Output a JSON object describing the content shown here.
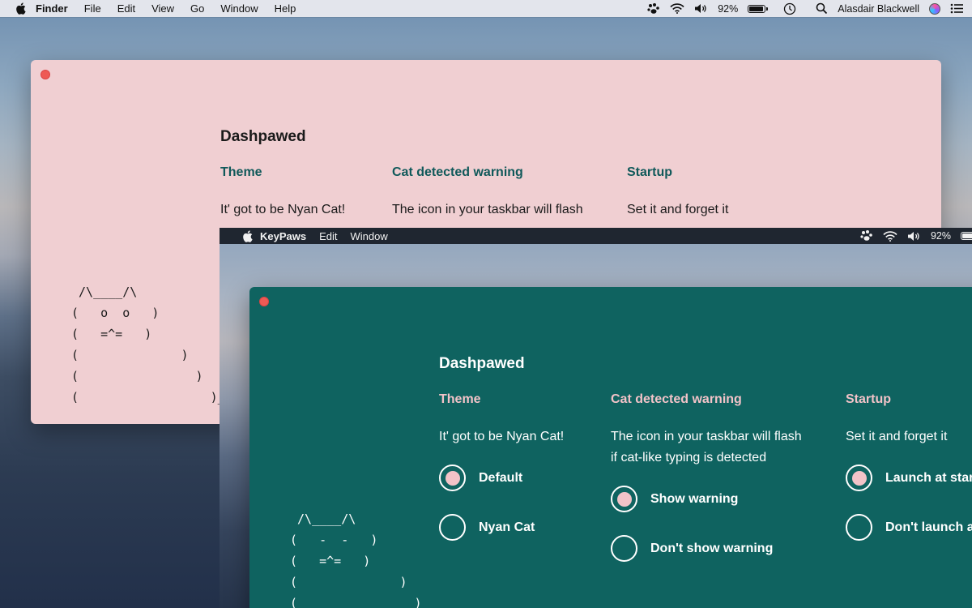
{
  "menubar": {
    "apple_icon": "apple-logo-icon",
    "app_name": "Finder",
    "items": [
      "File",
      "Edit",
      "View",
      "Go",
      "Window",
      "Help"
    ],
    "status": {
      "paw_icon": "paw-icon",
      "wifi_icon": "wifi-icon",
      "volume_icon": "volume-icon",
      "battery_percent": "92%",
      "battery_level": 0.92,
      "clock_icon": "clock-icon",
      "search_icon": "spotlight-search-icon",
      "user_name": "Alasdair Blackwell",
      "siri_icon": "siri-icon",
      "list_icon": "notification-center-icon"
    }
  },
  "pink_window": {
    "title": "Dashpawed",
    "ascii_cat": " /\\____/\\\n(   o  o   )\n(   =^=   )\n(              )\n(                )\n(                  )_____£",
    "columns": [
      {
        "heading": "Theme",
        "description": "It' got to be Nyan Cat!"
      },
      {
        "heading": "Cat detected warning",
        "description": "The icon in your taskbar will flash"
      },
      {
        "heading": "Startup",
        "description": "Set it and forget it"
      }
    ]
  },
  "screen2": {
    "menubar": {
      "app_name": "KeyPaws",
      "items": [
        "Edit",
        "Window"
      ],
      "battery_percent": "92%"
    },
    "window": {
      "title": "Dashpawed",
      "ascii_cat": " /\\____/\\\n(   -  -   )\n(   =^=   )\n(              )\n(                )",
      "columns": [
        {
          "heading": "Theme",
          "description": "It' got to be Nyan Cat!",
          "options": [
            {
              "label": "Default",
              "selected": true
            },
            {
              "label": "Nyan Cat",
              "selected": false
            }
          ]
        },
        {
          "heading": "Cat detected warning",
          "description": "The icon in your taskbar will flash\nif cat-like typing is detected",
          "options": [
            {
              "label": "Show warning",
              "selected": true
            },
            {
              "label": "Don't show warning",
              "selected": false
            }
          ]
        },
        {
          "heading": "Startup",
          "description": "Set it and forget it",
          "options": [
            {
              "label": "Launch at startup",
              "selected": true
            },
            {
              "label": "Don't launch at startup",
              "selected": false
            }
          ]
        }
      ]
    }
  },
  "colors": {
    "pink_bg": "#f0cfd2",
    "teal_bg": "#0f6360",
    "teal_heading": "#10595a",
    "pink_accent": "#f2c3c8",
    "close_button": "#ee5a55"
  }
}
